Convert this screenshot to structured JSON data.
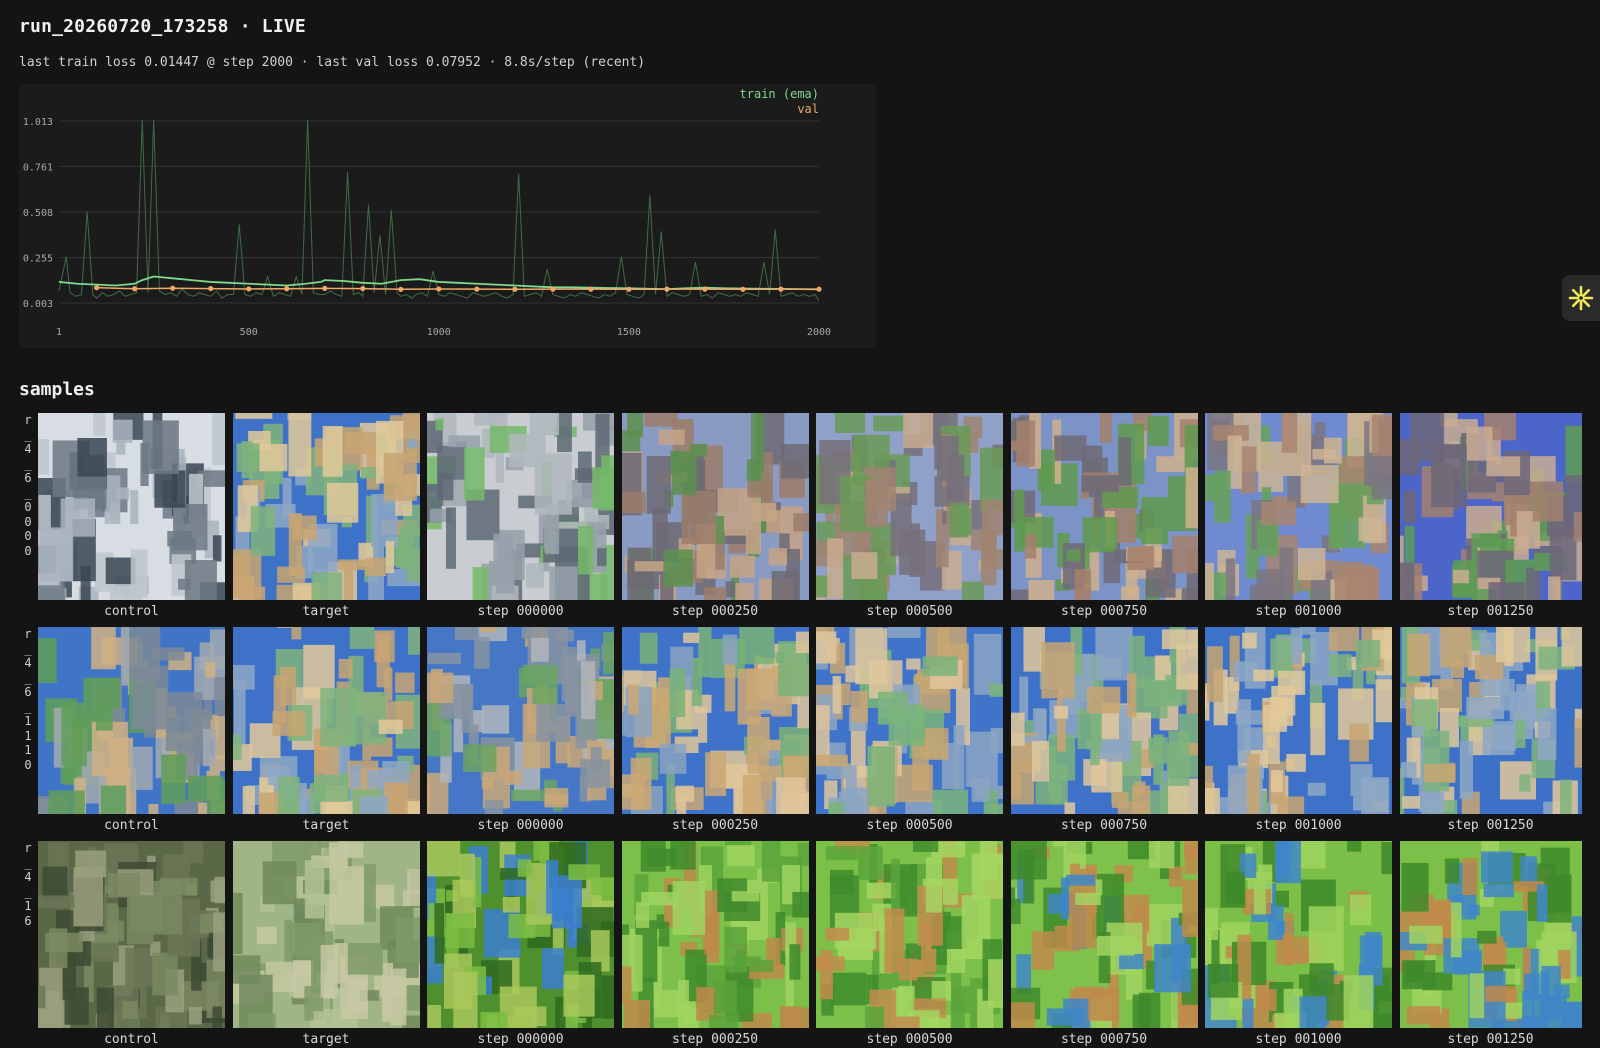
{
  "header": {
    "title": "run_20260720_173258 · LIVE",
    "status": "last train loss 0.01447 @ step 2000 · last val loss 0.07952 · 8.8s/step (recent)"
  },
  "chart_data": {
    "type": "line",
    "title": "",
    "xlabel": "",
    "ylabel": "",
    "xlim": [
      1,
      2000
    ],
    "ylim": [
      0.003,
      1.013
    ],
    "x_ticks": [
      "1",
      "500",
      "1000",
      "1500",
      "2000"
    ],
    "y_ticks": [
      "1.013",
      "0.761",
      "0.508",
      "0.255",
      "0.003"
    ],
    "grid": true,
    "legend_position": "top-right",
    "colors": {
      "train": "#7fd98a",
      "val": "#f0a868",
      "raw": "#3f6b46"
    },
    "series": [
      {
        "name": "train (ema)",
        "x": [
          1,
          50,
          100,
          150,
          200,
          220,
          250,
          300,
          350,
          400,
          450,
          500,
          550,
          600,
          650,
          690,
          700,
          750,
          800,
          850,
          900,
          950,
          1000,
          1050,
          1100,
          1150,
          1200,
          1250,
          1300,
          1350,
          1400,
          1450,
          1500,
          1550,
          1600,
          1650,
          1700,
          1750,
          1800,
          1850,
          1900,
          1950,
          2000
        ],
        "values": [
          0.12,
          0.11,
          0.105,
          0.1,
          0.11,
          0.13,
          0.15,
          0.14,
          0.13,
          0.12,
          0.115,
          0.11,
          0.105,
          0.1,
          0.11,
          0.12,
          0.13,
          0.125,
          0.115,
          0.11,
          0.13,
          0.135,
          0.12,
          0.115,
          0.11,
          0.105,
          0.1,
          0.095,
          0.09,
          0.09,
          0.088,
          0.086,
          0.085,
          0.082,
          0.08,
          0.085,
          0.088,
          0.085,
          0.083,
          0.082,
          0.081,
          0.08,
          0.079
        ]
      },
      {
        "name": "val",
        "x": [
          100,
          200,
          300,
          400,
          500,
          600,
          700,
          800,
          900,
          1000,
          1100,
          1200,
          1300,
          1400,
          1500,
          1600,
          1700,
          1800,
          1900,
          2000
        ],
        "values": [
          0.088,
          0.082,
          0.085,
          0.083,
          0.081,
          0.082,
          0.084,
          0.083,
          0.079,
          0.081,
          0.08,
          0.079,
          0.08,
          0.08,
          0.079,
          0.08,
          0.08,
          0.079,
          0.08,
          0.07952
        ]
      }
    ],
    "raw_train": {
      "x": [
        1,
        20,
        30,
        45,
        60,
        75,
        90,
        100,
        115,
        130,
        145,
        160,
        175,
        190,
        205,
        220,
        235,
        250,
        265,
        280,
        295,
        310,
        325,
        340,
        355,
        370,
        385,
        400,
        415,
        430,
        445,
        460,
        475,
        490,
        505,
        520,
        535,
        550,
        565,
        580,
        595,
        610,
        625,
        640,
        655,
        670,
        685,
        690,
        700,
        715,
        730,
        745,
        760,
        775,
        790,
        800,
        815,
        830,
        845,
        860,
        875,
        890,
        900,
        915,
        930,
        940,
        955,
        970,
        985,
        1000,
        1015,
        1030,
        1045,
        1060,
        1075,
        1090,
        1105,
        1120,
        1135,
        1150,
        1165,
        1180,
        1195,
        1210,
        1225,
        1240,
        1255,
        1270,
        1285,
        1300,
        1315,
        1330,
        1345,
        1360,
        1375,
        1390,
        1405,
        1420,
        1435,
        1450,
        1465,
        1480,
        1495,
        1510,
        1525,
        1540,
        1555,
        1570,
        1585,
        1600,
        1615,
        1630,
        1645,
        1660,
        1675,
        1690,
        1705,
        1720,
        1735,
        1750,
        1765,
        1780,
        1795,
        1810,
        1825,
        1840,
        1855,
        1870,
        1885,
        1900,
        1915,
        1930,
        1945,
        1960,
        1975,
        1990,
        2000
      ],
      "values": [
        0.07,
        0.26,
        0.06,
        0.04,
        0.05,
        0.51,
        0.05,
        0.03,
        0.06,
        0.04,
        0.05,
        0.07,
        0.04,
        0.05,
        0.06,
        1.02,
        0.06,
        1.02,
        0.07,
        0.05,
        0.06,
        0.04,
        0.08,
        0.05,
        0.04,
        0.06,
        0.05,
        0.04,
        0.07,
        0.03,
        0.05,
        0.05,
        0.44,
        0.05,
        0.04,
        0.06,
        0.05,
        0.15,
        0.04,
        0.06,
        0.05,
        0.04,
        0.15,
        0.05,
        1.02,
        0.06,
        0.05,
        0.05,
        0.05,
        0.07,
        0.05,
        0.04,
        0.73,
        0.05,
        0.06,
        0.04,
        0.55,
        0.06,
        0.38,
        0.05,
        0.52,
        0.06,
        0.04,
        0.05,
        0.03,
        0.05,
        0.06,
        0.04,
        0.18,
        0.05,
        0.04,
        0.06,
        0.05,
        0.04,
        0.03,
        0.06,
        0.05,
        0.04,
        0.05,
        0.06,
        0.04,
        0.03,
        0.05,
        0.72,
        0.04,
        0.05,
        0.06,
        0.04,
        0.19,
        0.05,
        0.04,
        0.03,
        0.05,
        0.04,
        0.06,
        0.05,
        0.04,
        0.03,
        0.05,
        0.04,
        0.06,
        0.26,
        0.05,
        0.04,
        0.03,
        0.05,
        0.6,
        0.05,
        0.4,
        0.04,
        0.06,
        0.05,
        0.04,
        0.05,
        0.23,
        0.04,
        0.05,
        0.03,
        0.06,
        0.05,
        0.04,
        0.05,
        0.04,
        0.06,
        0.05,
        0.04,
        0.23,
        0.05,
        0.41,
        0.04,
        0.05,
        0.06,
        0.04,
        0.05,
        0.04,
        0.05,
        0.014
      ]
    }
  },
  "samples": {
    "title": "samples",
    "rows": [
      {
        "label": "r\n_\n4\n_\n6\n_\n0\n0\n0\n0",
        "tiles": [
          {
            "caption": "control",
            "palette": [
              "#d7dde3",
              "#a9b4be",
              "#6c7884",
              "#3a4652",
              "#bfc6cc"
            ]
          },
          {
            "caption": "target",
            "palette": [
              "#3d72c8",
              "#c8a572",
              "#e2c99a",
              "#7fb37c",
              "#8ea7c4"
            ]
          },
          {
            "caption": "step 000000",
            "palette": [
              "#c9cdd2",
              "#97a0aa",
              "#5e6875",
              "#76b86a",
              "#b0b7bd"
            ]
          },
          {
            "caption": "step 000250",
            "palette": [
              "#8a9bc3",
              "#9b7d6a",
              "#c6a586",
              "#5c8f4d",
              "#6d6a74"
            ]
          },
          {
            "caption": "step 000500",
            "palette": [
              "#8fa1c8",
              "#a08472",
              "#c9ab90",
              "#6a9a57",
              "#75707a"
            ]
          },
          {
            "caption": "step 000750",
            "palette": [
              "#7c93c8",
              "#a4806d",
              "#d0b08c",
              "#5f9a4f",
              "#6f6a76"
            ]
          },
          {
            "caption": "step 001000",
            "palette": [
              "#6f8ad0",
              "#a88570",
              "#cdb494",
              "#65a15b",
              "#7b7582"
            ]
          },
          {
            "caption": "step 001250",
            "palette": [
              "#4c65c9",
              "#a3806f",
              "#c9ad92",
              "#5e9c54",
              "#6d6679"
            ]
          }
        ]
      },
      {
        "label": "r\n_\n4\n_\n6\n_\n1\n1\n1\n0",
        "tiles": [
          {
            "caption": "control",
            "palette": [
              "#3f74c7",
              "#cfb084",
              "#a2a9b1",
              "#5f9e58",
              "#7d8a97"
            ]
          },
          {
            "caption": "target",
            "palette": [
              "#3d72c8",
              "#c8a572",
              "#e2c99a",
              "#7fb37c",
              "#8ea7c4"
            ]
          },
          {
            "caption": "step 000000",
            "palette": [
              "#4577c6",
              "#caa778",
              "#b1b5bb",
              "#6aa361",
              "#8793a0"
            ]
          },
          {
            "caption": "step 000250",
            "palette": [
              "#3e73c9",
              "#cba874",
              "#e0c59a",
              "#78b276",
              "#8aa3c1"
            ]
          },
          {
            "caption": "step 000500",
            "palette": [
              "#3f74ca",
              "#c9a673",
              "#dfc69c",
              "#7ab47a",
              "#8ca4c2"
            ]
          },
          {
            "caption": "step 000750",
            "palette": [
              "#3e72c8",
              "#c7a472",
              "#e1c89b",
              "#7cb37b",
              "#8da6c3"
            ]
          },
          {
            "caption": "step 001000",
            "palette": [
              "#3d72c8",
              "#c8a572",
              "#e2c99a",
              "#7fb37c",
              "#8ea7c4"
            ]
          },
          {
            "caption": "step 001250",
            "palette": [
              "#3d71c8",
              "#c9a673",
              "#e1c89a",
              "#7eb47c",
              "#8ea7c4"
            ]
          }
        ]
      },
      {
        "label": "r\n_\n4\n_\n1\n6",
        "tiles": [
          {
            "caption": "control",
            "palette": [
              "#5a6848",
              "#7b8a62",
              "#3e4a33",
              "#9aa07f",
              "#6a7656"
            ]
          },
          {
            "caption": "target",
            "palette": [
              "#9fb487",
              "#c6c8a2",
              "#7f9a68",
              "#b3c196",
              "#6f8a5c"
            ]
          },
          {
            "caption": "step 000000",
            "palette": [
              "#4e8f2e",
              "#7bbd43",
              "#2f6a1f",
              "#3b7fd0",
              "#a9c85a"
            ]
          },
          {
            "caption": "step 000250",
            "palette": [
              "#7cc04a",
              "#9fd35f",
              "#3f8a2b",
              "#c08a4a",
              "#5aa33a"
            ]
          },
          {
            "caption": "step 000500",
            "palette": [
              "#7cc04a",
              "#a5d662",
              "#408c2c",
              "#c28c4c",
              "#5ba53b"
            ]
          },
          {
            "caption": "step 000750",
            "palette": [
              "#7ec24b",
              "#a2d460",
              "#3e892a",
              "#c08a4a",
              "#3f86c8"
            ]
          },
          {
            "caption": "step 001000",
            "palette": [
              "#7bbf49",
              "#a0d35e",
              "#3d8829",
              "#bf894a",
              "#3f86c8"
            ]
          },
          {
            "caption": "step 001250",
            "palette": [
              "#7cc04a",
              "#a1d45f",
              "#3e892a",
              "#c08a4a",
              "#3f86c8"
            ]
          }
        ]
      }
    ]
  },
  "fab": {
    "icon": "sparkle-icon",
    "color": "#f2e85a"
  }
}
